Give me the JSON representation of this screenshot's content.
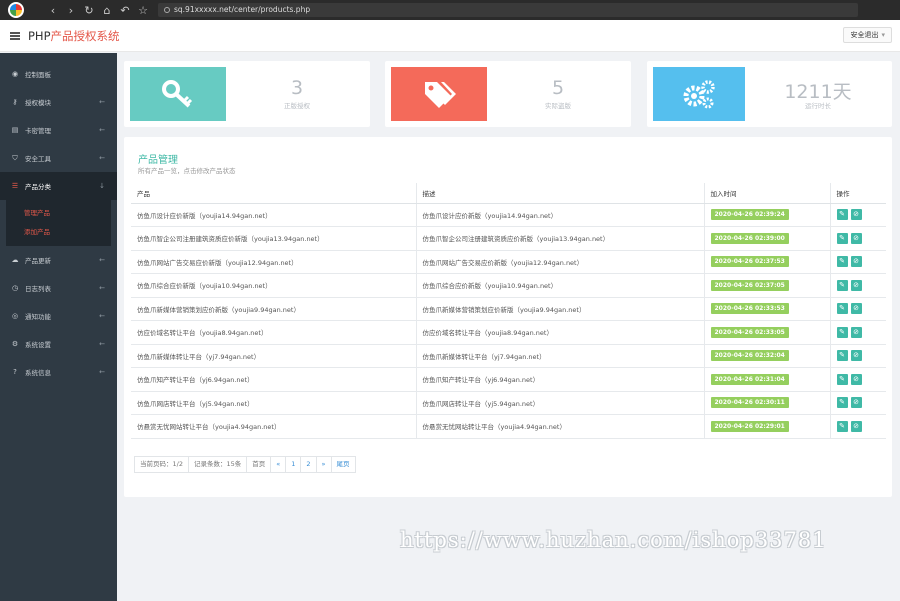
{
  "browser": {
    "url": "sq.91xxxxx.net/center/products.php",
    "nav_back": "‹",
    "nav_forward": "›",
    "reload": "↻",
    "home": "⌂",
    "undo": "↶",
    "star": "☆"
  },
  "header": {
    "title_prefix": "PHP",
    "title_main": "产品授权系统",
    "logout": "安全退出",
    "logout_caret": "▾"
  },
  "sidebar": {
    "items": [
      {
        "label": "控制面板",
        "icon": "dashboard-icon",
        "glyph": "◉",
        "arrow": ""
      },
      {
        "label": "授权模块",
        "icon": "key-icon",
        "glyph": "⚷",
        "arrow": "←"
      },
      {
        "label": "卡密管理",
        "icon": "card-icon",
        "glyph": "▤",
        "arrow": "←"
      },
      {
        "label": "安全工具",
        "icon": "shield-icon",
        "glyph": "⛉",
        "arrow": "←"
      },
      {
        "label": "产品分类",
        "icon": "list-icon",
        "glyph": "☰",
        "arrow": "↓"
      },
      {
        "label": "产品更新",
        "icon": "cloud-icon",
        "glyph": "☁",
        "arrow": "←"
      },
      {
        "label": "日志列表",
        "icon": "clock-icon",
        "glyph": "◷",
        "arrow": "←"
      },
      {
        "label": "通知功能",
        "icon": "bell-icon",
        "glyph": "◎",
        "arrow": "←"
      },
      {
        "label": "系统设置",
        "icon": "gears-icon",
        "glyph": "⚙",
        "arrow": "←"
      },
      {
        "label": "系统信息",
        "icon": "question-icon",
        "glyph": "?",
        "arrow": "←"
      }
    ],
    "sub_items": [
      "管理产品",
      "添加产品"
    ]
  },
  "stats": [
    {
      "value": "3",
      "label": "正版授权",
      "color": "#67cbc2",
      "icon": "key-icon"
    },
    {
      "value": "5",
      "label": "实际盗版",
      "color": "#f46a5a",
      "icon": "tags-icon"
    },
    {
      "value": "1211天",
      "label": "运行时长",
      "color": "#55bfee",
      "icon": "gears-icon"
    }
  ],
  "panel": {
    "title": "产品管理",
    "subtitle": "所有产品一览，点击修改产品状态",
    "columns": [
      "产品",
      "描述",
      "加入时间",
      "操作"
    ],
    "rows": [
      {
        "product": "仿鱼爪设计应价新版（youjia14.94gan.net）",
        "desc": "仿鱼爪设计应价新版（youjia14.94gan.net）",
        "date": "2020-04-26 02:39:24"
      },
      {
        "product": "仿鱼爪智企公司注册建筑资质应价新版（youjia13.94gan.net）",
        "desc": "仿鱼爪智企公司注册建筑资质应价新版（youjia13.94gan.net）",
        "date": "2020-04-26 02:39:00"
      },
      {
        "product": "仿鱼爪网站广告交易应价新版（youjia12.94gan.net）",
        "desc": "仿鱼爪网站广告交易应价新版（youjia12.94gan.net）",
        "date": "2020-04-26 02:37:53"
      },
      {
        "product": "仿鱼爪综合应价新版（youjia10.94gan.net）",
        "desc": "仿鱼爪综合应价新版（youjia10.94gan.net）",
        "date": "2020-04-26 02:37:05"
      },
      {
        "product": "仿鱼爪新媒体营销策划应价新版（youjia9.94gan.net）",
        "desc": "仿鱼爪新媒体营销策划应价新版（youjia9.94gan.net）",
        "date": "2020-04-26 02:33:53"
      },
      {
        "product": "仿应价域名转让平台（youjia8.94gan.net）",
        "desc": "仿应价域名转让平台（youjia8.94gan.net）",
        "date": "2020-04-26 02:33:05"
      },
      {
        "product": "仿鱼爪新媒体转让平台（yj7.94gan.net）",
        "desc": "仿鱼爪新媒体转让平台（yj7.94gan.net）",
        "date": "2020-04-26 02:32:04"
      },
      {
        "product": "仿鱼爪知产转让平台（yj6.94gan.net）",
        "desc": "仿鱼爪知产转让平台（yj6.94gan.net）",
        "date": "2020-04-26 02:31:04"
      },
      {
        "product": "仿鱼爪网店转让平台（yj5.94gan.net）",
        "desc": "仿鱼爪网店转让平台（yj5.94gan.net）",
        "date": "2020-04-26 02:30:11"
      },
      {
        "product": "仿悬赏无忧网站转让平台（youjia4.94gan.net）",
        "desc": "仿悬赏无忧网站转让平台（youjia4.94gan.net）",
        "date": "2020-04-26 02:29:01"
      }
    ],
    "pager": {
      "current": "当前页码：1/2",
      "records": "记录条数：15条",
      "first": "首页",
      "prev": "«",
      "page1": "1",
      "page2": "2",
      "next": "»",
      "last": "尾页"
    }
  },
  "watermark": "https://www.huzhan.com/ishop33781"
}
